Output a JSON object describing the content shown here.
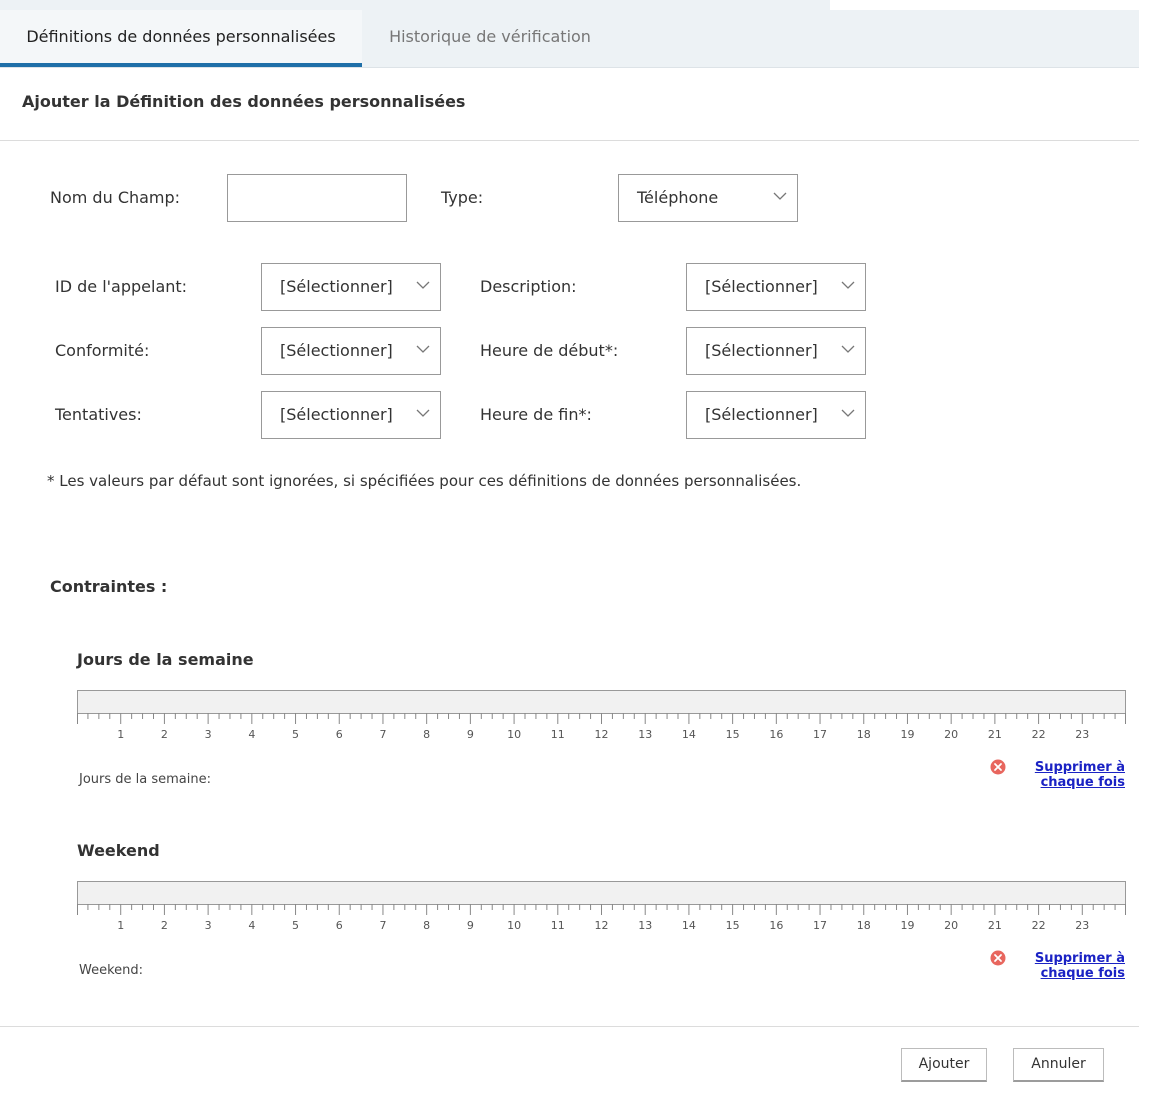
{
  "tabs": [
    {
      "label": "Définitions de données personnalisées",
      "active": true
    },
    {
      "label": "Historique de vérification",
      "active": false
    }
  ],
  "section_title": "Ajouter la Définition des données personnalisées",
  "form": {
    "field_name": {
      "label": "Nom du Champ:",
      "value": ""
    },
    "type": {
      "label": "Type:",
      "value": "Téléphone"
    },
    "caller_id": {
      "label": "ID de l'appelant:",
      "value": "[Sélectionner]"
    },
    "description": {
      "label": "Description:",
      "value": "[Sélectionner]"
    },
    "compliance": {
      "label": "Conformité:",
      "value": "[Sélectionner]"
    },
    "start_time": {
      "label": "Heure de début*:",
      "value": "[Sélectionner]"
    },
    "attempts": {
      "label": "Tentatives:",
      "value": "[Sélectionner]"
    },
    "end_time": {
      "label": "Heure de fin*:",
      "value": "[Sélectionner]"
    }
  },
  "note": "* Les valeurs par défaut sont ignorées, si spécifiées pour ces définitions de données personnalisées.",
  "constraints_title": "Contraintes :",
  "hour_labels": [
    "1",
    "2",
    "3",
    "4",
    "5",
    "6",
    "7",
    "8",
    "9",
    "10",
    "11",
    "12",
    "13",
    "14",
    "15",
    "16",
    "17",
    "18",
    "19",
    "20",
    "21",
    "22",
    "23"
  ],
  "weekdays": {
    "title": "Jours de la semaine",
    "label": "Jours de la semaine:",
    "delete_line1": "Supprimer à",
    "delete_line2": "chaque fois"
  },
  "weekend": {
    "title": "Weekend",
    "label": "Weekend:",
    "delete_line1": "Supprimer à",
    "delete_line2": "chaque fois"
  },
  "buttons": {
    "add": "Ajouter",
    "cancel": "Annuler"
  },
  "colors": {
    "accent": "#1f6fa8",
    "link": "#1a22c4",
    "delete_icon": "#e8665e",
    "tab_bg": "#edf2f5"
  }
}
